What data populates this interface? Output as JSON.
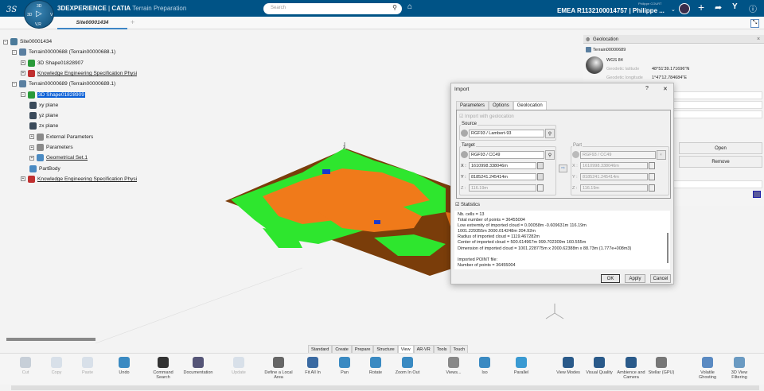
{
  "header": {
    "brand": "3DEXPERIENCE",
    "separator": "|",
    "product": "CATIA",
    "app": "Terrain Preparation",
    "search_placeholder": "Search",
    "user_small": "Philippe COURT",
    "tenant": "EMEA R1132100014757 | Philippe ...",
    "compass": {
      "top": "3D",
      "left": "3D",
      "right": "V",
      "bottom": "V,R"
    }
  },
  "tabs": {
    "active": "Site00001434",
    "add": "+"
  },
  "tree": [
    {
      "label": "Site00001434",
      "level": 0,
      "icon": "site-icon"
    },
    {
      "label": "Terrain00000688 (Terrain00000688.1)",
      "level": 1,
      "icon": "terrain-icon"
    },
    {
      "label": "3D Shape01828907",
      "level": 2,
      "icon": "shape-icon"
    },
    {
      "label": "Knowledge Engineering Specification Physi",
      "level": 2,
      "icon": "knowledge-icon",
      "underline": true
    },
    {
      "label": "Terrain00000689 (Terrain00000689.1)",
      "level": 1,
      "icon": "terrain-icon"
    },
    {
      "label": "3D Shape01828909",
      "level": 2,
      "icon": "shape-icon",
      "selected": true
    },
    {
      "label": "xy plane",
      "level": 3,
      "icon": "plane-icon"
    },
    {
      "label": "yz plane",
      "level": 3,
      "icon": "plane-icon"
    },
    {
      "label": "zx plane",
      "level": 3,
      "icon": "plane-icon"
    },
    {
      "label": "External Parameters",
      "level": 3,
      "icon": "parameters-icon"
    },
    {
      "label": "Parameters",
      "level": 3,
      "icon": "parameters-icon"
    },
    {
      "label": "Geometrical Set.1",
      "level": 3,
      "icon": "geometrical-set-icon",
      "underline": true
    },
    {
      "label": "PartBody",
      "level": 3,
      "icon": "partbody-icon"
    },
    {
      "label": "Knowledge Engineering Specification Physi",
      "level": 2,
      "icon": "knowledge-icon",
      "underline": true
    }
  ],
  "geolocation": {
    "title": "Geolocation",
    "terrain": "Terrain00000689",
    "system": "WGS 84",
    "lat_label": "Geodetic latitude",
    "lat": "48°51'39.171696\"N",
    "lon_label": "Geodetic longitude",
    "lon": "1°47'12.784684\"E",
    "open": "Open",
    "remove": "Remove"
  },
  "dialog": {
    "title": "Import",
    "help": "?",
    "close": "✕",
    "tabs": [
      "Parameters",
      "Options",
      "Geolocation"
    ],
    "active_tab": "Geolocation",
    "import_geo": "Import with geolocation",
    "source_label": "Source",
    "source": "RGF93 / Lambert-93",
    "target_label": "Target",
    "target": "RGF93 / CC49",
    "x": "1610998.338046m",
    "y": "8185241.245414m",
    "z": "116.19m",
    "part_label": "Part",
    "part": "RGF93 / CC49",
    "px": "1610998.338046m",
    "py": "8185241.245414m",
    "pz": "116.19m",
    "x_label": "X :",
    "y_label": "Y :",
    "z_label": "Z :",
    "statistics": "Statistics",
    "stats": [
      "Nb. cells = 13",
      "Total number of points = 36455004",
      "Low extremity of imported cloud = 0.00058m -0.609631m 116.19m",
      "1001.229355m 2000.014248m 204.92m",
      "Radius of imported cloud = 1119.467282m",
      "Center of imported cloud = 500.614967m 999.702309m 160.555m",
      "Dimension of imported cloud = 1001.228775m x 2000.62388m x 88.73m (1.777e+008m3)",
      "",
      "Imported POINT file:",
      "Number of points = 36455004"
    ],
    "ok": "OK",
    "apply": "Apply",
    "cancel": "Cancel"
  },
  "axis_label": "z",
  "toolbar_tabs": [
    "Standard",
    "Create",
    "Prepare",
    "Structure",
    "View",
    "AR-VR",
    "Tools",
    "Touch"
  ],
  "toolbar_active": "View",
  "tools": [
    {
      "label": "Cut",
      "icon": "scissors-icon",
      "disabled": true
    },
    {
      "label": "Copy",
      "icon": "copy-icon",
      "disabled": true
    },
    {
      "label": "Paste",
      "icon": "paste-icon",
      "disabled": true
    },
    {
      "label": "Undo",
      "icon": "undo-icon"
    },
    {
      "label": "Command Search",
      "icon": "command-search-icon"
    },
    {
      "label": "Documentation",
      "icon": "book-icon"
    },
    {
      "label": "Update",
      "icon": "update-icon",
      "disabled": true
    },
    {
      "label": "Define a Local Area",
      "icon": "local-area-icon"
    },
    {
      "label": "Fit All In",
      "icon": "fit-all-icon"
    },
    {
      "label": "Pan",
      "icon": "pan-icon"
    },
    {
      "label": "Rotate",
      "icon": "rotate-icon"
    },
    {
      "label": "Zoom In Out",
      "icon": "zoom-icon"
    },
    {
      "label": "Views...",
      "icon": "views-icon"
    },
    {
      "label": "Iso",
      "icon": "iso-icon"
    },
    {
      "label": "Parallel",
      "icon": "parallel-icon"
    },
    {
      "label": "View Modes",
      "icon": "view-modes-icon"
    },
    {
      "label": "Visual Quality",
      "icon": "visual-quality-icon"
    },
    {
      "label": "Ambience and Camera",
      "icon": "ambience-icon"
    },
    {
      "label": "Stellar (GPU)",
      "icon": "stellar-icon"
    },
    {
      "label": "Volatile Ghosting",
      "icon": "ghosting-icon"
    },
    {
      "label": "3D View Filtering",
      "icon": "view-filter-icon"
    }
  ],
  "colors": {
    "topbar": "#005386",
    "terrain_ground": "#7a3d0a",
    "vegetation": "#2ee62e",
    "buildings": "#f07a1a",
    "water": "#1a3acc",
    "selection": "#0a5fd6"
  }
}
